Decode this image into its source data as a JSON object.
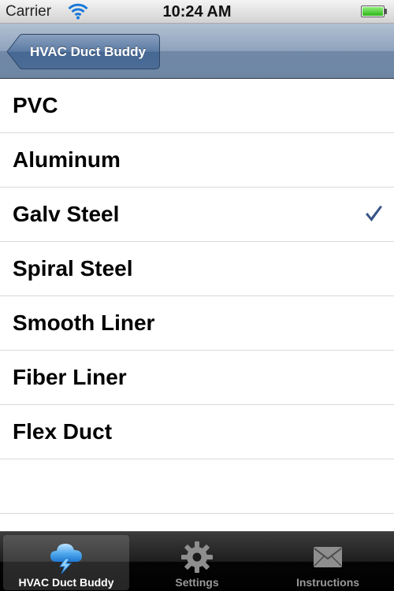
{
  "status_bar": {
    "carrier": "Carrier",
    "time": "10:24 AM",
    "battery_level": 1.0
  },
  "nav_bar": {
    "back_label": "HVAC Duct Buddy"
  },
  "materials": [
    {
      "label": "PVC",
      "selected": false
    },
    {
      "label": "Aluminum",
      "selected": false
    },
    {
      "label": "Galv Steel",
      "selected": true
    },
    {
      "label": "Spiral Steel",
      "selected": false
    },
    {
      "label": "Smooth Liner",
      "selected": false
    },
    {
      "label": "Fiber Liner",
      "selected": false
    },
    {
      "label": "Flex Duct",
      "selected": false
    }
  ],
  "tabs": [
    {
      "label": "HVAC Duct Buddy",
      "icon": "cloud-lightning-icon",
      "selected": true
    },
    {
      "label": "Settings",
      "icon": "gear-icon",
      "selected": false
    },
    {
      "label": "Instructions",
      "icon": "envelope-icon",
      "selected": false
    }
  ],
  "colors": {
    "checkmark": "#385487",
    "nav_bar": "#7f96b3",
    "selected_tab_icon": "#3a9be8"
  }
}
